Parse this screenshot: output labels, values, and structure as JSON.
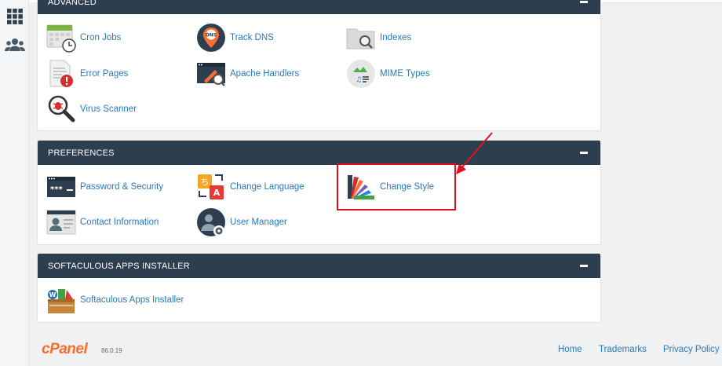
{
  "sections": {
    "advanced": {
      "title": "ADVANCED",
      "items": [
        {
          "label": "Cron Jobs",
          "icon": "calendar-clock-icon"
        },
        {
          "label": "Track DNS",
          "icon": "dns-pin-icon"
        },
        {
          "label": "Indexes",
          "icon": "folder-search-icon"
        },
        {
          "label": "Error Pages",
          "icon": "error-page-icon"
        },
        {
          "label": "Apache Handlers",
          "icon": "apache-handler-icon"
        },
        {
          "label": "MIME Types",
          "icon": "mime-types-icon"
        },
        {
          "label": "Virus Scanner",
          "icon": "virus-scanner-icon"
        }
      ]
    },
    "preferences": {
      "title": "PREFERENCES",
      "items": [
        {
          "label": "Password & Security",
          "icon": "password-icon"
        },
        {
          "label": "Change Language",
          "icon": "language-icon"
        },
        {
          "label": "Change Style",
          "icon": "style-palette-icon"
        },
        {
          "label": "Contact Information",
          "icon": "contact-card-icon"
        },
        {
          "label": "User Manager",
          "icon": "user-manager-icon"
        }
      ]
    },
    "softaculous": {
      "title": "SOFTACULOUS APPS INSTALLER",
      "items": [
        {
          "label": "Softaculous Apps Installer",
          "icon": "softaculous-icon"
        }
      ]
    }
  },
  "footer": {
    "logo": "cPanel",
    "version": "86.0.19",
    "links": [
      "Home",
      "Trademarks",
      "Privacy Policy"
    ]
  },
  "colors": {
    "header_bg": "#2d3e4f",
    "link": "#2a79b8",
    "highlight": "#e2101c",
    "logo": "#ff6c2c"
  }
}
